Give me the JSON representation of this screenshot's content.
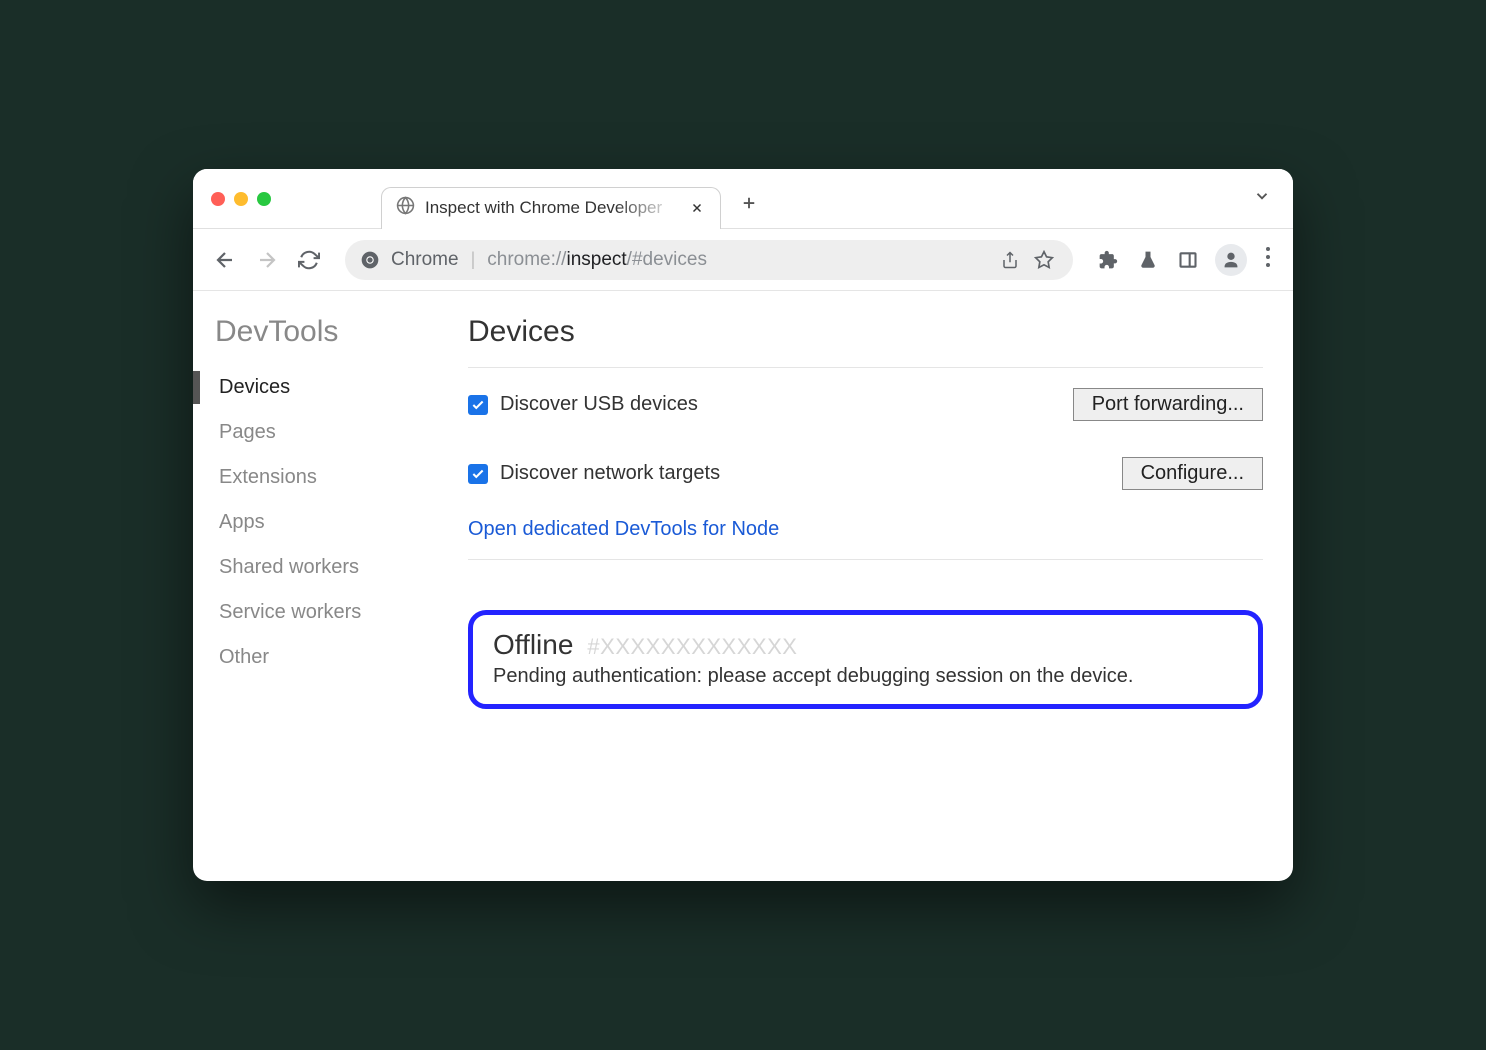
{
  "titlebar": {
    "tab_title": "Inspect with Chrome Developer"
  },
  "toolbar": {
    "addr_label": "Chrome",
    "addr_url_prefix": "chrome://",
    "addr_url_main": "inspect",
    "addr_url_suffix": "/#devices"
  },
  "sidebar": {
    "title": "DevTools",
    "items": [
      {
        "label": "Devices",
        "active": true
      },
      {
        "label": "Pages",
        "active": false
      },
      {
        "label": "Extensions",
        "active": false
      },
      {
        "label": "Apps",
        "active": false
      },
      {
        "label": "Shared workers",
        "active": false
      },
      {
        "label": "Service workers",
        "active": false
      },
      {
        "label": "Other",
        "active": false
      }
    ]
  },
  "main": {
    "title": "Devices",
    "discover_usb_label": "Discover USB devices",
    "port_forwarding_btn": "Port forwarding...",
    "discover_network_label": "Discover network targets",
    "configure_btn": "Configure...",
    "node_link": "Open dedicated DevTools for Node",
    "offline": {
      "label": "Offline",
      "id": "#XXXXXXXXXXXXX",
      "message": "Pending authentication: please accept debugging session on the device."
    }
  }
}
